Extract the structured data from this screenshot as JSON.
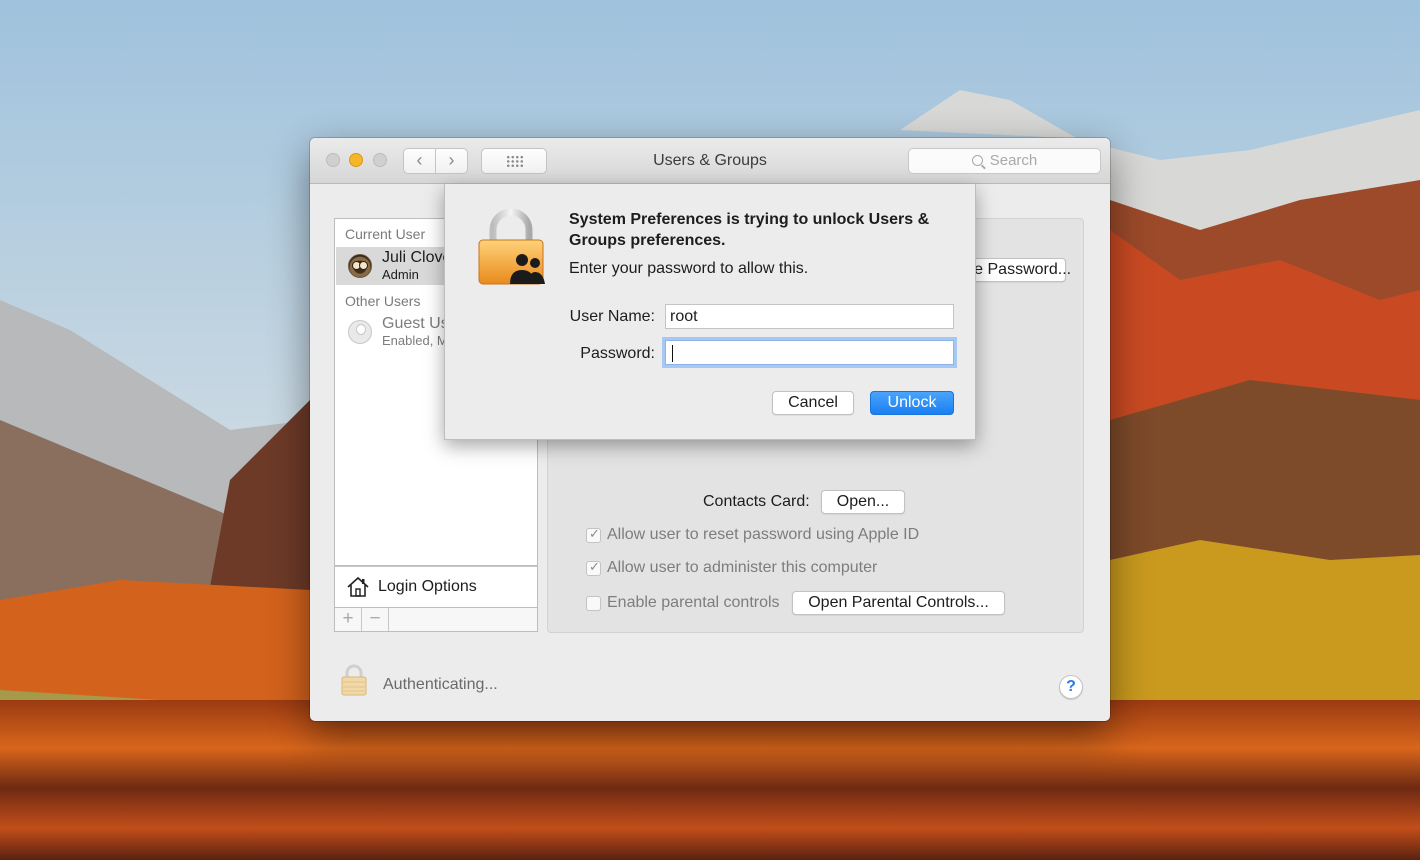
{
  "window": {
    "title": "Users & Groups",
    "search_placeholder": "Search",
    "back_glyph": "‹",
    "forward_glyph": "›"
  },
  "users": {
    "current_header": "Current User",
    "current": {
      "name": "Juli Clover",
      "role": "Admin"
    },
    "other_header": "Other Users",
    "guest": {
      "name": "Guest User",
      "status": "Enabled, Managed"
    }
  },
  "login_options": "Login Options",
  "list_controls": {
    "add": "+",
    "remove": "−"
  },
  "detail": {
    "change_password_button": "Change Password...",
    "contacts_label": "Contacts Card:",
    "open_button": "Open...",
    "options": [
      {
        "label": "Allow user to reset password using Apple ID",
        "checked": true
      },
      {
        "label": "Allow user to administer this computer",
        "checked": true
      },
      {
        "label": "Enable parental controls",
        "checked": false
      }
    ],
    "parental_button": "Open Parental Controls..."
  },
  "footer": {
    "status": "Authenticating...",
    "help": "?"
  },
  "dialog": {
    "title": "System Preferences is trying to unlock Users & Groups preferences.",
    "subtitle": "Enter your password to allow this.",
    "username_label": "User Name:",
    "username_value": "root",
    "password_label": "Password:",
    "password_value": "",
    "cancel": "Cancel",
    "unlock": "Unlock"
  },
  "colors": {
    "accent": "#1a7ff2",
    "focus_ring": "#a7c8f2",
    "minimize": "#f5b629",
    "padlock": "#f2a33a"
  }
}
